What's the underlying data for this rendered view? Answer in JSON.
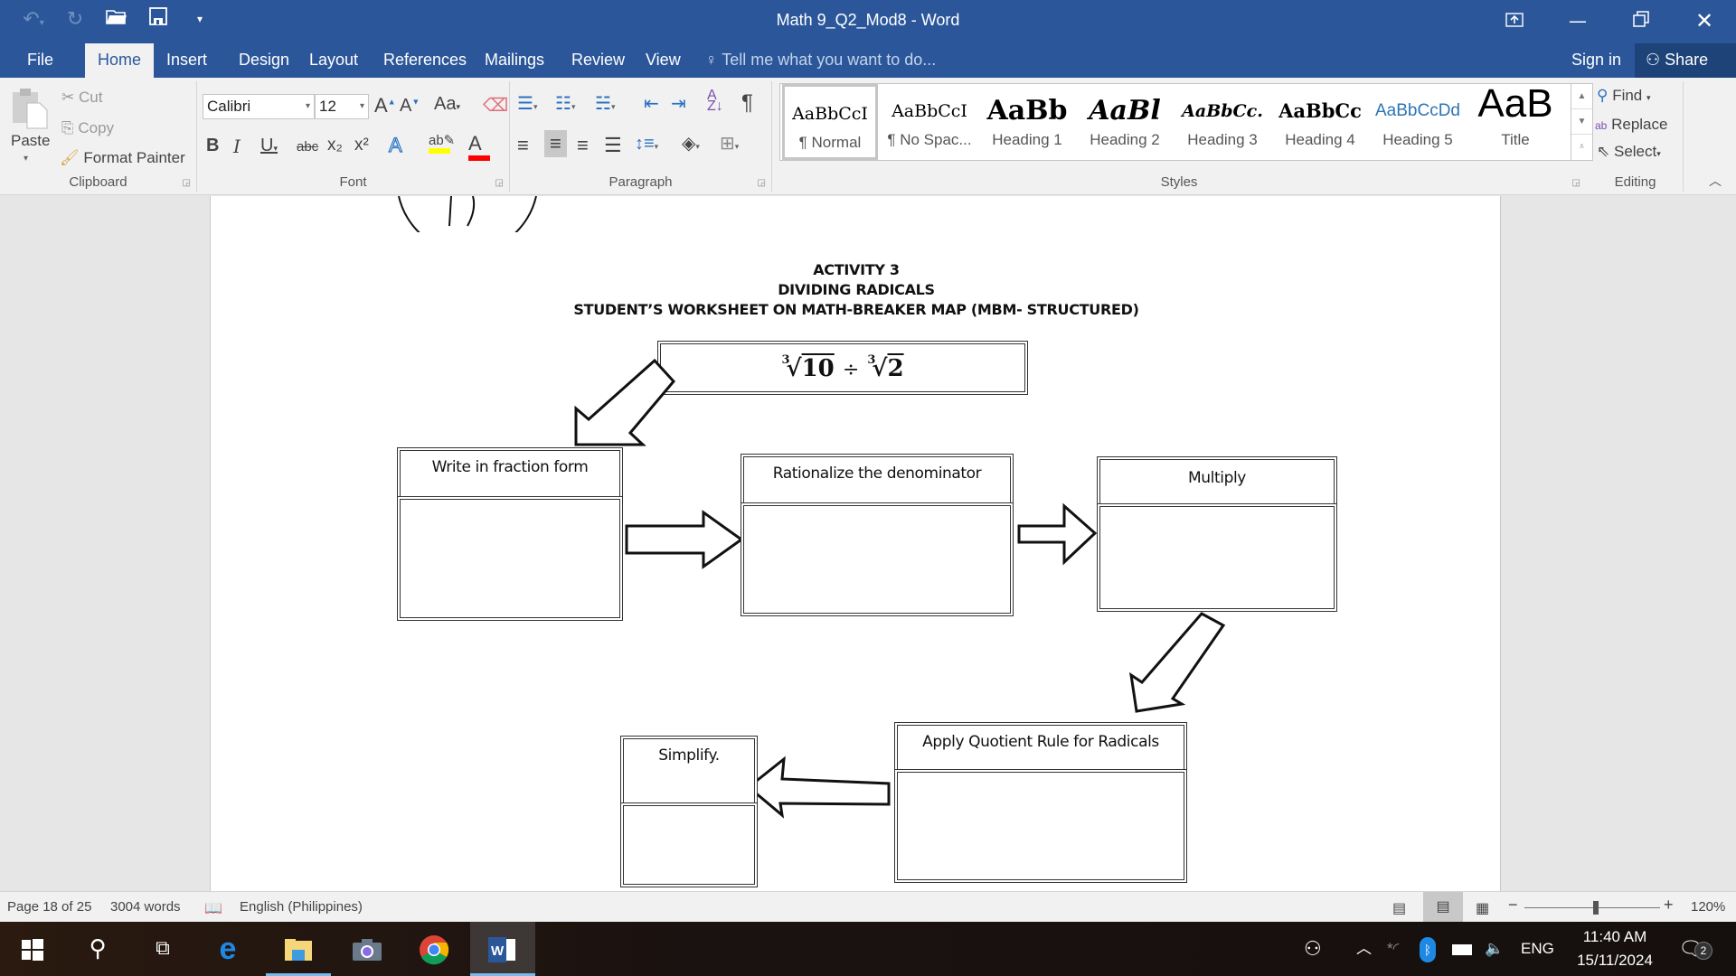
{
  "window": {
    "title": "Math 9_Q2_Mod8 - Word",
    "controls": {
      "ribbon_display": "ribbon-display-options-icon",
      "minimize": "minimize-icon",
      "restore": "restore-icon",
      "close": "close-icon"
    }
  },
  "qat": {
    "undo": "undo-icon",
    "redo": "redo-icon",
    "open": "open-folder-icon",
    "save": "save-icon",
    "customize": "customize-qat-icon"
  },
  "tabs": [
    {
      "label": "File"
    },
    {
      "label": "Home",
      "active": true
    },
    {
      "label": "Insert"
    },
    {
      "label": "Design"
    },
    {
      "label": "Layout"
    },
    {
      "label": "References"
    },
    {
      "label": "Mailings"
    },
    {
      "label": "Review"
    },
    {
      "label": "View"
    }
  ],
  "tell_me": {
    "placeholder": "Tell me what you want to do..."
  },
  "account": {
    "sign_in": "Sign in",
    "share": "Share"
  },
  "ribbon": {
    "clipboard": {
      "label": "Clipboard",
      "paste": "Paste",
      "cut": "Cut",
      "copy": "Copy",
      "format_painter": "Format Painter"
    },
    "font": {
      "label": "Font",
      "font_name": "Calibri",
      "font_size": "12",
      "bold": "B",
      "italic": "I",
      "underline": "U",
      "strikethrough": "abc",
      "subscript": "x₂",
      "superscript": "x²",
      "change_case": "Aa",
      "highlight_color": "#ffff00",
      "font_color": "#ff0000"
    },
    "paragraph": {
      "label": "Paragraph",
      "show_marks": "¶"
    },
    "styles": {
      "label": "Styles",
      "items": [
        {
          "preview": "AaBbCcI",
          "name": "¶ Normal",
          "selected": true
        },
        {
          "preview": "AaBbCcI",
          "name": "¶ No Spac..."
        },
        {
          "preview": "AaBb",
          "name": "Heading 1"
        },
        {
          "preview": "AaBl",
          "name": "Heading 2"
        },
        {
          "preview": "AaBbCc.",
          "name": "Heading 3"
        },
        {
          "preview": "AaBbCc",
          "name": "Heading 4"
        },
        {
          "preview": "AaBbCcDd",
          "name": "Heading 5"
        },
        {
          "preview": "AaB",
          "name": "Title"
        }
      ]
    },
    "editing": {
      "label": "Editing",
      "find": "Find",
      "replace": "Replace",
      "select": "Select"
    }
  },
  "document": {
    "heading_lines": [
      "ACTIVITY 3",
      "DIVIDING RADICALS",
      "STUDENT’S WORKSHEET ON MATH-BREAKER MAP (MBM- STRUCTURED)"
    ],
    "problem": {
      "index1": "3",
      "radicand1": "10",
      "operator": "÷",
      "index2": "3",
      "radicand2": "2"
    },
    "steps": [
      {
        "label": "Write in fraction form",
        "answer": ""
      },
      {
        "label": "Rationalize the denominator",
        "answer": ""
      },
      {
        "label": "Multiply",
        "answer": ""
      },
      {
        "label": "Apply Quotient Rule for Radicals",
        "answer": ""
      },
      {
        "label": "Simplify.",
        "answer": ""
      }
    ]
  },
  "status": {
    "page": "Page 18 of 25",
    "words": "3004 words",
    "language": "English (Philippines)",
    "zoom": "120%",
    "zoom_percent": 120
  },
  "taskbar": {
    "apps": [
      "start",
      "search",
      "task-view",
      "edge",
      "file-explorer",
      "camera",
      "chrome",
      "word"
    ],
    "language": "ENG",
    "time": "11:40 AM",
    "date": "15/11/2024",
    "notifications": "2"
  }
}
